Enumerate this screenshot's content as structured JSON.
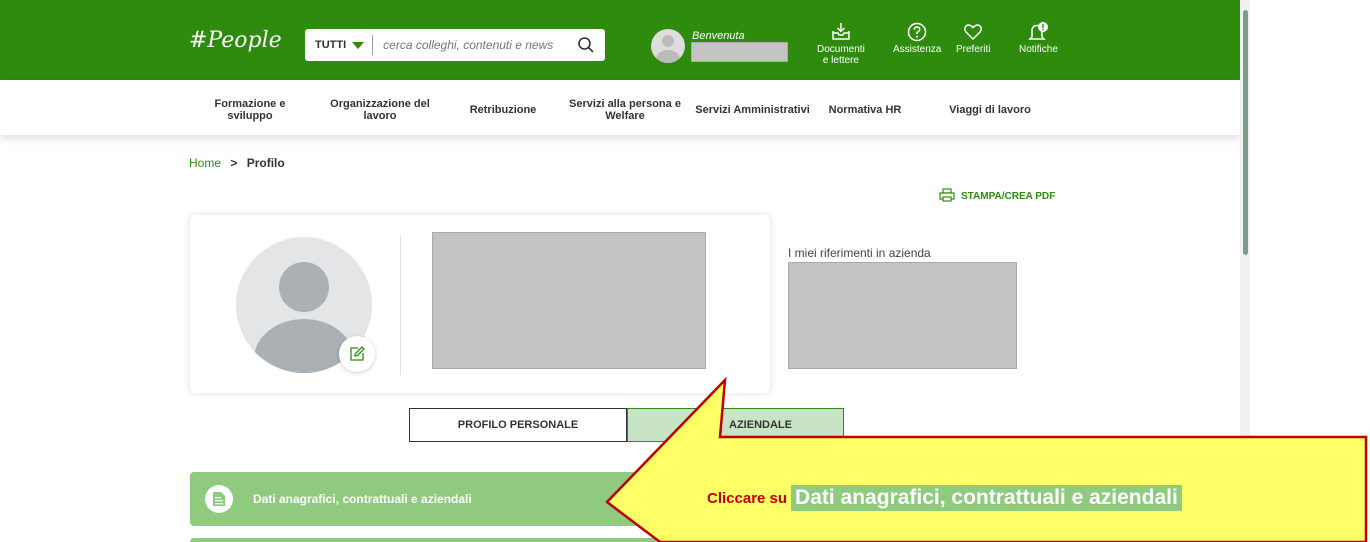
{
  "header": {
    "logo": "#People",
    "search": {
      "category": "TUTTI",
      "placeholder": "cerca colleghi, contenuti e news"
    },
    "welcome": "Benvenuta",
    "icons": [
      {
        "icon": "inbox-download-icon",
        "label_line1": "Documenti",
        "label_line2": "e lettere"
      },
      {
        "icon": "help-circle-icon",
        "label_line1": "Assistenza",
        "label_line2": ""
      },
      {
        "icon": "heart-icon",
        "label_line1": "Preferiti",
        "label_line2": ""
      },
      {
        "icon": "bell-icon",
        "label_line1": "Notifiche",
        "label_line2": "",
        "badge": "!"
      }
    ]
  },
  "nav": {
    "items": [
      {
        "line1": "Formazione e",
        "line2": "sviluppo"
      },
      {
        "line1": "Organizzazione del",
        "line2": "lavoro"
      },
      {
        "line1": "Retribuzione",
        "line2": ""
      },
      {
        "line1": "Servizi alla persona e",
        "line2": "Welfare"
      },
      {
        "line1": "Servizi Amministrativi",
        "line2": ""
      },
      {
        "line1": "Normativa HR",
        "line2": ""
      },
      {
        "line1": "Viaggi di lavoro",
        "line2": ""
      }
    ]
  },
  "breadcrumb": {
    "home": "Home",
    "separator": ">",
    "current": "Profilo"
  },
  "print_label": "STAMPA/CREA PDF",
  "profile": {
    "references_label": "I miei riferimenti in azienda"
  },
  "tabs": {
    "personal": "PROFILO PERSONALE",
    "company": "PROFILO AZIENDALE",
    "company_visible": "AZIENDALE"
  },
  "accordion": {
    "label": "Dati anagrafici, contrattuali e aziendali"
  },
  "callout": {
    "prefix": "Cliccare su",
    "highlight": "Dati anagrafici, contrattuali e aziendali"
  },
  "colors": {
    "brand_green": "#2e8b0e",
    "light_green": "#8fca7f",
    "callout_yellow": "#ffff66",
    "callout_border": "#c00000"
  }
}
